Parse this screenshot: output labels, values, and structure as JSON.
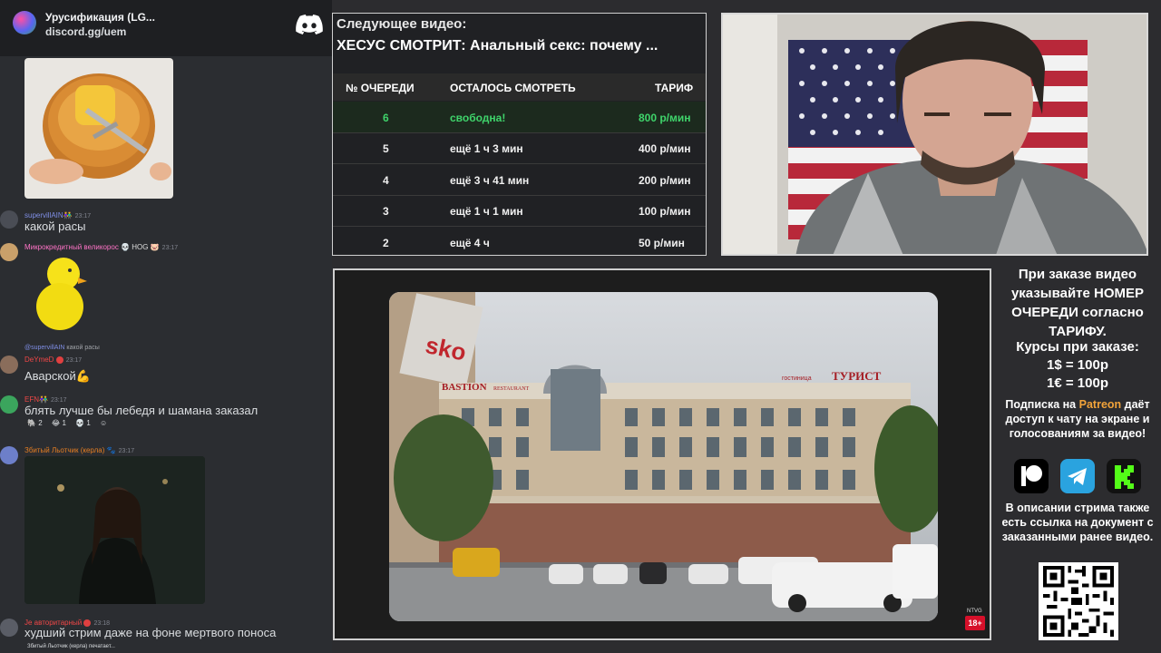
{
  "discord": {
    "server_name": "Урусификация (LG...",
    "invite": "discord.gg/uem",
    "messages": [
      {
        "user": "supervillAIN",
        "badge": "👫",
        "time": "23:17",
        "text": "какой расы",
        "color": "#7289da"
      },
      {
        "user": "Микрокредитный великорос",
        "badge": "💀 HOG 🐷",
        "time": "23:17",
        "text": "",
        "color": "#ff73c7"
      },
      {
        "reply_to": "@supervillAIN",
        "reply_text": "какой расы",
        "user": "DeYmeD",
        "time": "23:17",
        "text": "Аварской💪",
        "color": "#f04747"
      },
      {
        "user": "EFN",
        "badge": "👫",
        "time": "23:17",
        "text": "блять лучше бы лебедя и шамана заказал",
        "color": "#f04747",
        "reactions": [
          "2",
          "1",
          "1"
        ]
      },
      {
        "user": "Збитый Льотчик (керла)",
        "time": "23:17",
        "text": "",
        "color": "#e67e22"
      },
      {
        "user": "Je авторитарный",
        "time": "23:18",
        "text": "худший стрим даже на фоне мертвого поноса",
        "color": "#f04747"
      }
    ],
    "typing": "Збитый Льотчик (керла) печатает..."
  },
  "queue": {
    "next_label": "Следующее видео:",
    "next_title": "ХЕСУС СМОТРИТ: Анальный секс: почему ...",
    "headers": [
      "№ ОЧЕРЕДИ",
      "ОСТАЛОСЬ СМОТРЕТЬ",
      "ТАРИФ"
    ],
    "rows": [
      {
        "num": "6",
        "left": "свободна!",
        "price": "800 р/мин",
        "free": true
      },
      {
        "num": "5",
        "left": "ещё 1 ч 3 мин",
        "price": "400 р/мин",
        "free": false
      },
      {
        "num": "4",
        "left": "ещё 3 ч 41 мин",
        "price": "200 р/мин",
        "free": false
      },
      {
        "num": "3",
        "left": "ещё 1 ч 1 мин",
        "price": "100 р/мин",
        "free": false
      },
      {
        "num": "2",
        "left": "ещё 4 ч",
        "price": "50 р/мин",
        "free": false
      }
    ]
  },
  "video": {
    "sign_bastion": "BASTION",
    "sign_restaurant": "RESTAURANT",
    "sign_hotel_prefix": "гостиница",
    "sign_hotel": "ТУРИСТ",
    "sign_sko": "sko",
    "age_rating": "18+",
    "channel_mark": "NTVG"
  },
  "info": {
    "order_text": "При заказе видео указывайте НОМЕР ОЧЕРЕДИ согласно ТАРИФУ.",
    "rates_title": "Курсы при заказе:",
    "rate_usd": "1$ = 100р",
    "rate_eur": "1€ = 100р",
    "sub_prefix": "Подписка на",
    "sub_brand": "Patreon",
    "sub_suffix": "даёт доступ к чату на экране и голосованиям за видео!",
    "desc_text": "В описании стрима также есть ссылка на документ с заказанными ранее видео.",
    "socials": [
      "patreon-icon",
      "telegram-icon",
      "kick-icon"
    ]
  },
  "colors": {
    "green": "#3fd46b",
    "patreon": "#f2a33a",
    "telegram": "#2aa3df",
    "kick": "#53fc18",
    "discord_blurple": "#5865f2"
  }
}
